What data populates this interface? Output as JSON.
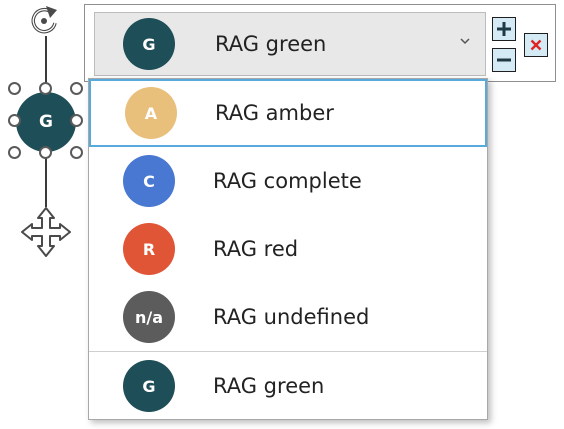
{
  "canvas_shape": {
    "letter": "G",
    "color": "#1e4e57"
  },
  "combo": {
    "selected": {
      "letter": "G",
      "label": "RAG green",
      "color": "#1e4e57"
    },
    "chevron_icon": "chevron-down-icon"
  },
  "buttons": {
    "plus_icon": "plus-icon",
    "minus_icon": "minus-icon",
    "close_icon": "close-icon",
    "close_color": "#e02424"
  },
  "options": [
    {
      "letter": "A",
      "label": "RAG amber",
      "color": "#e9bf7c",
      "highlighted": true
    },
    {
      "letter": "C",
      "label": "RAG complete",
      "color": "#4878d1",
      "highlighted": false
    },
    {
      "letter": "R",
      "label": "RAG red",
      "color": "#e05535",
      "highlighted": false
    },
    {
      "letter": "n/a",
      "label": "RAG undefined",
      "color": "#5c5c5c",
      "highlighted": false
    },
    {
      "letter": "G",
      "label": "RAG green",
      "color": "#1e4e57",
      "highlighted": false
    }
  ],
  "colors": {
    "highlight_border": "#58a9dc",
    "button_fill": "#d4eaf4"
  }
}
